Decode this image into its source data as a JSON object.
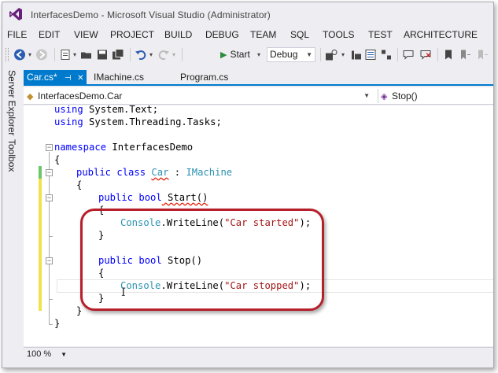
{
  "window": {
    "title": "InterfacesDemo - Microsoft Visual Studio (Administrator)"
  },
  "menu": [
    "FILE",
    "EDIT",
    "VIEW",
    "PROJECT",
    "BUILD",
    "DEBUG",
    "TEAM",
    "SQL",
    "TOOLS",
    "TEST",
    "ARCHITECTURE"
  ],
  "toolbar": {
    "start_label": "Start",
    "config_value": "Debug"
  },
  "side_panel": {
    "server_explorer": "Server Explorer",
    "toolbox": "Toolbox"
  },
  "tabs": [
    {
      "label": "Car.cs*",
      "active": true
    },
    {
      "label": "IMachine.cs",
      "active": false
    },
    {
      "label": "Program.cs",
      "active": false
    }
  ],
  "nav": {
    "type_value": "InterfacesDemo.Car",
    "member_value": "Stop()"
  },
  "code": {
    "line1_kw": "using",
    "line1_rest": " System.Text;",
    "line2_kw": "using",
    "line2_rest": " System.Threading.Tasks;",
    "ns_kw": "namespace",
    "ns_name": " InterfacesDemo",
    "open_brace": "{",
    "close_brace": "}",
    "class_mods": "public class",
    "class_name": "Car",
    "class_colon": " : ",
    "class_iface": "IMachine",
    "method1_sig_kw": "public bool",
    "method1_name": " Start()",
    "console": "Console",
    "writeline": ".WriteLine(",
    "str_started": "\"Car started\"",
    "call_end": ");",
    "method2_sig_kw": "public bool",
    "method2_name": " Stop()",
    "str_stopped": "\"Car stopped\""
  },
  "zoom": {
    "value": "100 %"
  },
  "colors": {
    "accent": "#007acc",
    "keyword": "#0000ff",
    "type": "#2b91af",
    "string": "#a31515",
    "annotation_oval": "#b61f2a",
    "change_bar_saved": "#6cc76c",
    "change_bar_unsaved": "#f0e34a"
  }
}
